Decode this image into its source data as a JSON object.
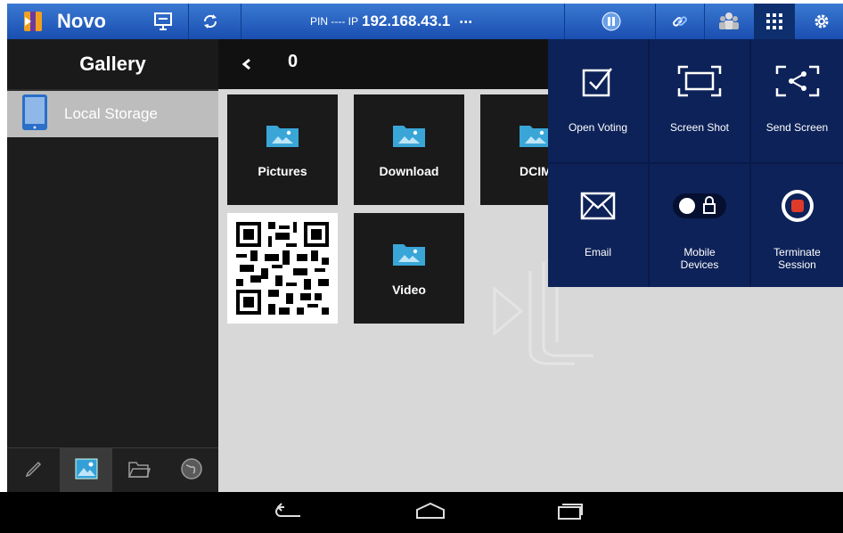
{
  "topbar": {
    "app_title": "Novo",
    "pin_label": "PIN ---- IP",
    "ip": "192.168.43.1",
    "more": "..."
  },
  "sidebar": {
    "title": "Gallery",
    "storage_item": "Local Storage"
  },
  "main": {
    "path_count": "0",
    "folders": [
      "Pictures",
      "Download",
      "DCIM",
      "Video"
    ]
  },
  "menu": {
    "items": [
      {
        "label": "Open Voting",
        "icon": "checkbox-icon"
      },
      {
        "label": "Screen Shot",
        "icon": "screenshot-icon"
      },
      {
        "label": "Send Screen",
        "icon": "share-icon"
      },
      {
        "label": "Email",
        "icon": "envelope-icon"
      },
      {
        "label": "Mobile\nDevices",
        "icon": "lock-toggle-icon"
      },
      {
        "label": "Terminate\nSession",
        "icon": "stop-icon"
      }
    ]
  },
  "colors": {
    "topbar": "#2a62c4",
    "menu_bg": "#0d2258",
    "stop_red": "#e03a2a"
  }
}
